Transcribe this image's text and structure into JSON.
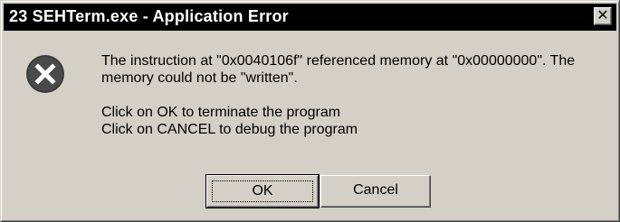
{
  "window": {
    "title": "23 SEHTerm.exe - Application Error",
    "close_glyph": "✕"
  },
  "message": {
    "line1": "The instruction at \"0x0040106f\" referenced memory at \"0x00000000\". The",
    "line2": "memory could not be \"written\".",
    "line3": "Click on OK to terminate the program",
    "line4": "Click on CANCEL to debug the program"
  },
  "buttons": {
    "ok_label": "OK",
    "cancel_label": "Cancel"
  },
  "icons": {
    "error": "error-circle-x-icon",
    "close": "close-icon"
  },
  "colors": {
    "titlebar_bg": "#000000",
    "titlebar_text": "#ffffff",
    "dialog_bg": "#d4d0c8",
    "icon_fill": "#404040"
  }
}
